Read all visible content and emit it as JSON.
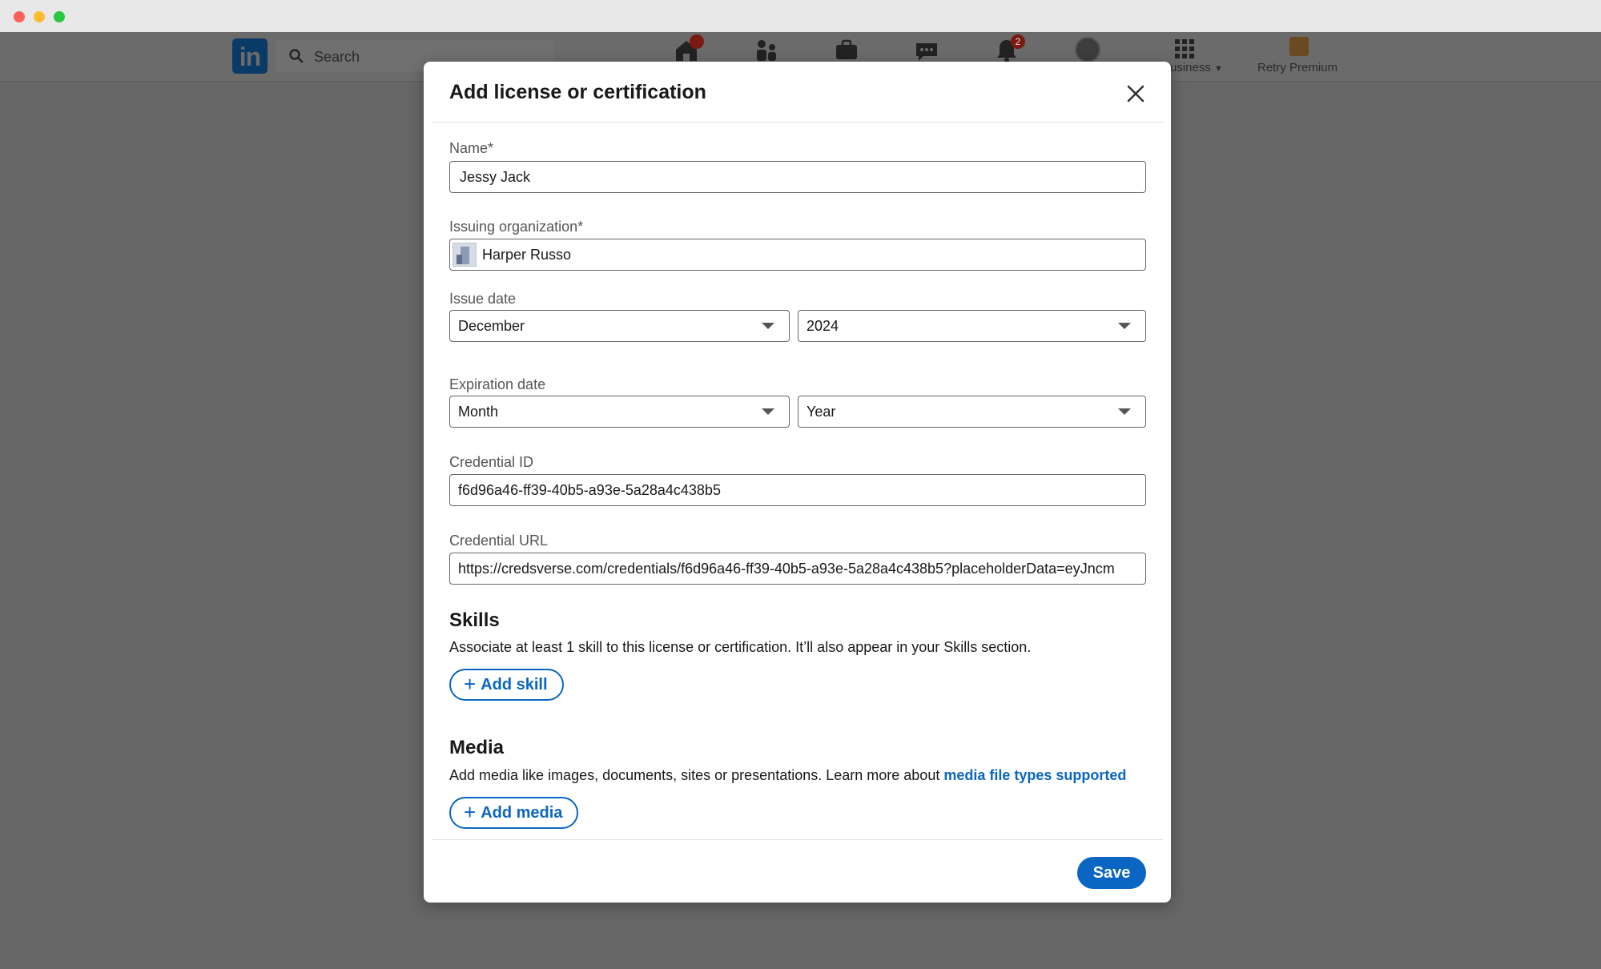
{
  "nav": {
    "search_placeholder": "Search",
    "home_badge": "",
    "notifications_badge": "2",
    "business_label": "usiness",
    "premium_label": "Retry Premium"
  },
  "modal": {
    "title": "Add license or certification",
    "fields": {
      "name_label": "Name*",
      "name_value": "Jessy Jack",
      "org_label": "Issuing organization*",
      "org_value": "Harper Russo",
      "issue_date_label": "Issue date",
      "issue_month": "December",
      "issue_year": "2024",
      "expiration_label": "Expiration date",
      "expiration_month": "Month",
      "expiration_year": "Year",
      "credential_id_label": "Credential ID",
      "credential_id_value": "f6d96a46-ff39-40b5-a93e-5a28a4c438b5",
      "credential_url_label": "Credential URL",
      "credential_url_value": "https://credsverse.com/credentials/f6d96a46-ff39-40b5-a93e-5a28a4c438b5?placeholderData=eyJncm"
    },
    "skills": {
      "title": "Skills",
      "description": "Associate at least 1 skill to this license or certification. It’ll also appear in your Skills section.",
      "button": "Add skill"
    },
    "media": {
      "title": "Media",
      "description": "Add media like images, documents, sites or presentations. Learn more about ",
      "link": "media file types supported",
      "button": "Add media"
    },
    "save_label": "Save"
  },
  "colors": {
    "accent": "#0a66c2",
    "backdrop": "#666666"
  }
}
